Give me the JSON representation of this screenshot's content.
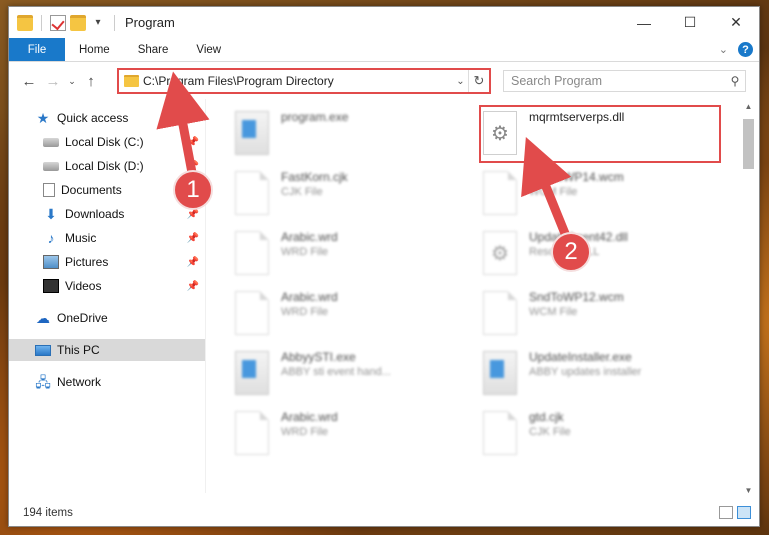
{
  "titlebar": {
    "title": "Program",
    "controls": {
      "minimize": "—",
      "maximize": "☐",
      "close": "✕"
    }
  },
  "ribbon": {
    "tabs": [
      "File",
      "Home",
      "Share",
      "View"
    ],
    "help": "?"
  },
  "address": {
    "path": "C:\\Program Files\\Program Directory",
    "search_placeholder": "Search Program"
  },
  "sidebar": {
    "items": [
      {
        "label": "Quick access",
        "icon": "star-icon",
        "pinned": false
      },
      {
        "label": "Local Disk (C:)",
        "icon": "disk-icon",
        "pinned": true
      },
      {
        "label": "Local Disk (D:)",
        "icon": "disk-icon",
        "pinned": true
      },
      {
        "label": "Documents",
        "icon": "documents-icon",
        "pinned": true
      },
      {
        "label": "Downloads",
        "icon": "downloads-icon",
        "pinned": true
      },
      {
        "label": "Music",
        "icon": "music-icon",
        "pinned": true
      },
      {
        "label": "Pictures",
        "icon": "pictures-icon",
        "pinned": true
      },
      {
        "label": "Videos",
        "icon": "videos-icon",
        "pinned": true
      },
      {
        "label": "OneDrive",
        "icon": "onedrive-icon",
        "pinned": false
      },
      {
        "label": "This PC",
        "icon": "pc-icon",
        "pinned": false,
        "selected": true
      },
      {
        "label": "Network",
        "icon": "network-icon",
        "pinned": false
      }
    ]
  },
  "files": [
    {
      "name": "program.exe",
      "type": "",
      "icon": "exe-icon"
    },
    {
      "name": "mqrmtserverps.dll",
      "type": "",
      "icon": "dll-gear-icon"
    },
    {
      "name": "FastKorn.cjk",
      "type": "CJK File",
      "icon": "document-icon"
    },
    {
      "name": "SndToWP14.wcm",
      "type": "WCM File",
      "icon": "document-icon"
    },
    {
      "name": "Arabic.wrd",
      "type": "WRD File",
      "icon": "document-icon"
    },
    {
      "name": "UpdateAgent42.dll",
      "type": "Resource DLL",
      "icon": "dll-gear-icon"
    },
    {
      "name": "Arabic.wrd",
      "type": "WRD File",
      "icon": "document-icon"
    },
    {
      "name": "SndToWP12.wcm",
      "type": "WCM File",
      "icon": "document-icon"
    },
    {
      "name": "AbbyySTI.exe",
      "type": "ABBY sti event hand...",
      "icon": "exe-icon"
    },
    {
      "name": "UpdateInstaller.exe",
      "type": "ABBY updates installer",
      "icon": "exe-icon"
    },
    {
      "name": "Arabic.wrd",
      "type": "WRD File",
      "icon": "document-icon"
    },
    {
      "name": "gtd.cjk",
      "type": "CJK File",
      "icon": "document-icon"
    }
  ],
  "status": {
    "item_count": "194 items"
  },
  "annotations": {
    "badge1": "1",
    "badge2": "2"
  },
  "colors": {
    "accent": "#1979ca",
    "highlight": "#e14b4b"
  }
}
